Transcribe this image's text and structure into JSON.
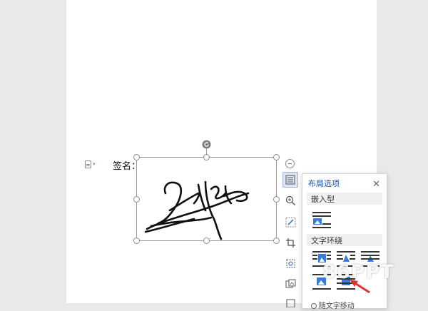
{
  "document": {
    "signature_label": "签名："
  },
  "layout_panel": {
    "title": "布局选项",
    "inline_section": "嵌入型",
    "wrap_section": "文字环绕",
    "bottom_item_partial": "随文字移动"
  },
  "watermark": {
    "text": "86PPT"
  },
  "colors": {
    "accent_blue": "#1d4fa3",
    "layout_icon_blue": "#3a7bd5",
    "arrow_red": "#e0332b"
  }
}
